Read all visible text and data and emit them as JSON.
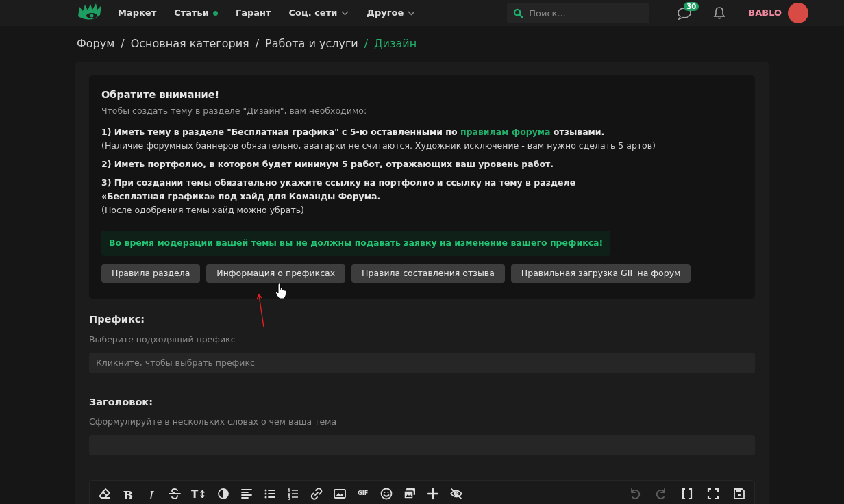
{
  "nav": {
    "items": [
      {
        "label": "Маркет",
        "dot": false,
        "dropdown": false
      },
      {
        "label": "Статьи",
        "dot": true,
        "dropdown": false
      },
      {
        "label": "Гарант",
        "dot": false,
        "dropdown": false
      },
      {
        "label": "Соц. сети",
        "dot": false,
        "dropdown": true
      },
      {
        "label": "Другое",
        "dot": false,
        "dropdown": true
      }
    ],
    "search": {
      "placeholder": "Поиск..."
    },
    "messages_badge": "30",
    "username": "BABLO"
  },
  "breadcrumbs": [
    {
      "label": "Форум",
      "current": false
    },
    {
      "label": "Основная категория",
      "current": false
    },
    {
      "label": "Работа и услуги",
      "current": false
    },
    {
      "label": "Дизайн",
      "current": true
    }
  ],
  "breadcrumb_separator": "/",
  "notice": {
    "title": "Обратите внимание!",
    "intro": "Чтобы создать тему в разделе \"Дизайн\", вам необходимо:",
    "rules": [
      {
        "lines": [
          {
            "text": "1) Иметь тему в разделе \"Бесплатная графика\" с 5-ю оставленными по",
            "bold": true,
            "link": "правилам форума",
            "after": "отзывами."
          },
          {
            "text": "(Наличие форумных баннеров обязательно, аватарки не считаются. Художник исключение - вам нужно сделать 5 артов)",
            "bold": false
          }
        ]
      },
      {
        "lines": [
          {
            "text": "2) Иметь портфолио, в котором будет минимум 5 работ, отражающих ваш уровень работ.",
            "bold": true
          }
        ]
      },
      {
        "lines": [
          {
            "text": "3) При создании темы обязательно укажите ссылку на портфолио и ссылку на тему в разделе",
            "bold": true
          },
          {
            "text": "«Бесплатная графика» под хайд для Команды Форума.",
            "bold": true
          },
          {
            "text": "(После одобрения темы хайд можно убрать)",
            "bold": false
          }
        ]
      }
    ],
    "warning": "Во время модерации вашей темы вы не должны подавать заявку на изменение вашего префикса!",
    "buttons": [
      "Правила раздела",
      "Информация о префиксах",
      "Правила составления отзыва",
      "Правильная загрузка GIF на форум"
    ]
  },
  "fields": [
    {
      "label": "Префикс:",
      "hint": "Выберите подходящий префикс",
      "placeholder": "Кликните, чтобы выбрать префикс"
    },
    {
      "label": "Заголовок:",
      "hint": "Сформулируйте в нескольких словах о чем ваша тема"
    }
  ],
  "editor_toolbar": {
    "labels": [
      "B",
      "I",
      "T↕",
      "GIF"
    ],
    "undo": {
      "disabled": true
    },
    "redo": {
      "disabled": true
    }
  }
}
